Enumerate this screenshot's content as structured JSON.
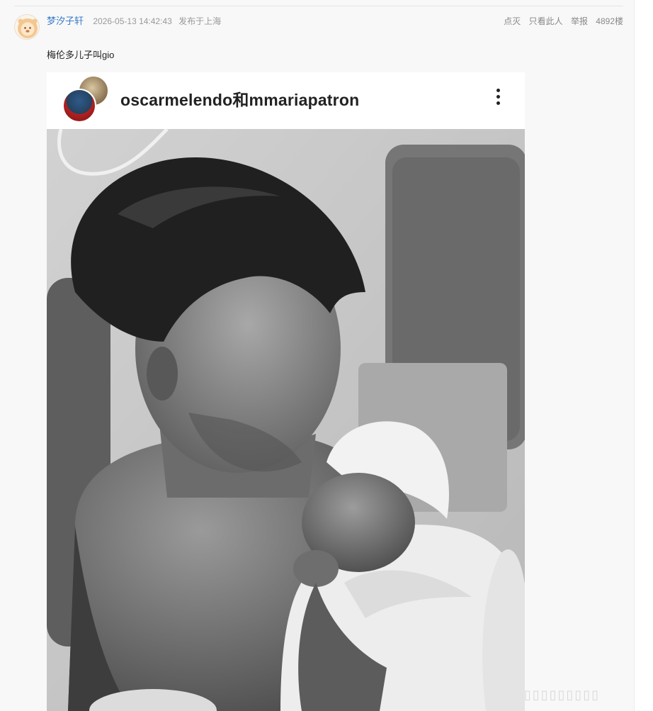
{
  "post": {
    "username": "梦汐子轩",
    "timestamp": "2026-05-13 14:42:43",
    "location": "发布于上海",
    "text": "梅伦多儿子叫gio"
  },
  "actions": {
    "diss": "点灭",
    "only_author": "只看此人",
    "report": "举报",
    "floor": "4892楼"
  },
  "shared_image": {
    "account_names": "oscarmelendo和mmariapatron",
    "more_icon": "more-vertical-icon"
  },
  "colors": {
    "username": "#3a7bc8",
    "meta_gray": "#999999",
    "background": "#f8f8f8"
  }
}
